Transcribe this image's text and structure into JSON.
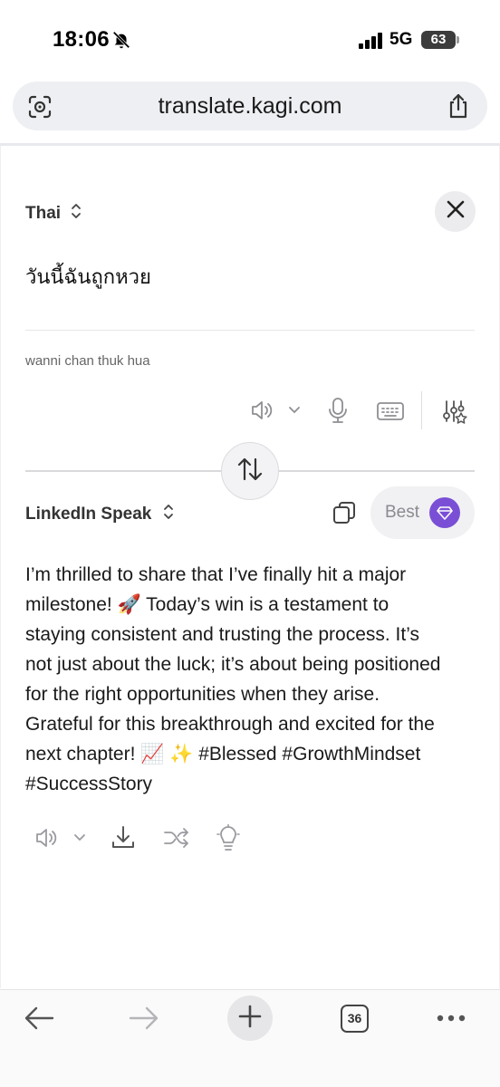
{
  "status_bar": {
    "time": "18:06",
    "network": "5G",
    "battery": "63"
  },
  "browser": {
    "url": "translate.kagi.com"
  },
  "source": {
    "language": "Thai",
    "text": "วันนี้ฉันถูกหวย",
    "transliteration": "wanni chan thuk hua"
  },
  "target": {
    "language": "LinkedIn Speak",
    "quality_label": "Best",
    "output_lines": [
      "I’m thrilled to share that I’ve finally hit a major",
      "milestone! 🚀 Today’s win is a testament to",
      "staying consistent and trusting the process. It’s",
      "not just about the luck; it’s about being positioned",
      "for the right opportunities when they arise.",
      "Grateful for this breakthrough and excited for the",
      "next chapter! 📈 ✨ #Blessed #GrowthMindset",
      "#SuccessStory"
    ]
  },
  "toolbar": {
    "tab_count": "36"
  },
  "icons": {
    "speaker": "speaker-icon",
    "microphone": "microphone-icon",
    "keyboard": "keyboard-icon",
    "settings": "sliders-star-icon",
    "download": "download-icon",
    "shuffle": "shuffle-icon",
    "idea": "lightbulb-icon",
    "copy": "copy-icon",
    "gem": "gem-icon"
  },
  "colors": {
    "accent": "#7a4fd6",
    "pill_bg": "#f1f1f3",
    "icon_gray": "#8e8e93"
  }
}
